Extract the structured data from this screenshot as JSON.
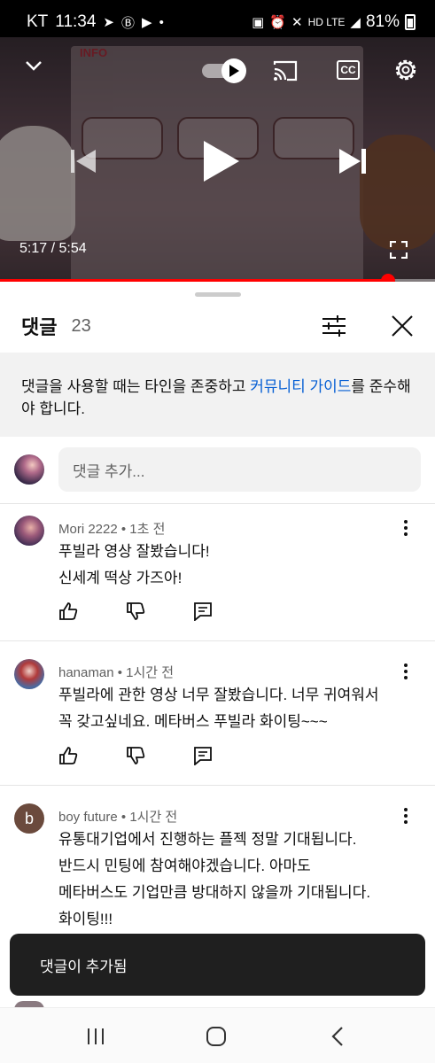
{
  "status_bar": {
    "carrier": "KT",
    "time": "11:34",
    "right_text": "HD LTE",
    "battery": "81%"
  },
  "player": {
    "poster_badge": "INFO",
    "time_current": "5:17",
    "time_total": "5:54",
    "time_display": "5:17 / 5:54",
    "progress": 0.893,
    "cc_label": "CC",
    "icons": [
      "chevron-down-icon",
      "autoplay-toggle",
      "cast-icon",
      "cc-icon",
      "settings-gear-icon",
      "previous-icon",
      "play-icon",
      "next-icon",
      "fullscreen-icon"
    ]
  },
  "comments_panel": {
    "title": "댓글",
    "count": "23",
    "notice_pre": "댓글을 사용할 때는 타인을 존중하고 ",
    "notice_link": "커뮤니티 가이드",
    "notice_post": "를 준수해야 합니다.",
    "add_placeholder": "댓글 추가..."
  },
  "comments": [
    {
      "author": "Mori 2222",
      "time": "1초 전",
      "lines": [
        "푸빌라 영상 잘봤습니다!",
        "신세계 떡상 가즈아!"
      ]
    },
    {
      "author": "hanaman",
      "time": "1시간 전",
      "lines": [
        "푸빌라에 관한 영상 너무 잘봤습니다. 너무 귀여워서",
        "꼭 갖고싶네요. 메타버스 푸빌라 화이팅~~~"
      ]
    },
    {
      "author": "boy future",
      "time": "1시간 전",
      "avatar_letter": "b",
      "lines": [
        "유통대기업에서 진행하는 플젝 정말 기대됩니다.",
        "반드시 민팅에 참여해야겠습니다. 아마도",
        "메타버스도 기업만큼 방대하지 않을까 기대됩니다.",
        "화이팅!!!"
      ]
    }
  ],
  "toast": {
    "text": "댓글이 추가됨"
  },
  "colors": {
    "link": "#065fd4",
    "progress": "#ff0000",
    "toast_bg": "#1f1f1f"
  }
}
